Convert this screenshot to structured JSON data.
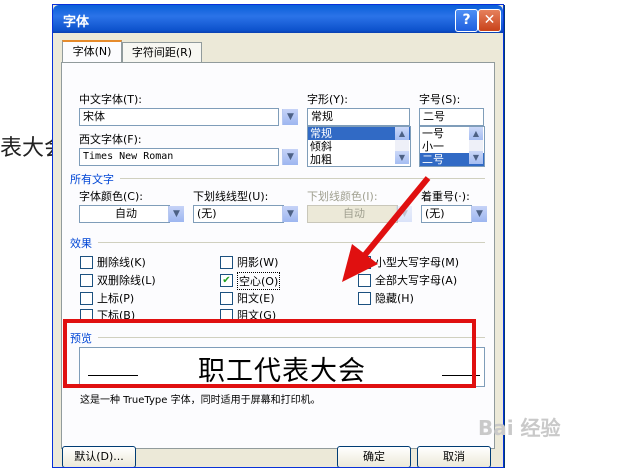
{
  "background_doc": {
    "text": "表大会"
  },
  "dialog": {
    "title": "字体",
    "help_icon_label": "?",
    "close_icon_label": "✕"
  },
  "tabs": [
    {
      "label": "字体(N)",
      "active": true
    },
    {
      "label": "字符间距(R)",
      "active": false
    }
  ],
  "font_section": {
    "chinese_font_label": "中文字体(T):",
    "chinese_font_value": "宋体",
    "western_font_label": "西文字体(F):",
    "western_font_value": "Times New Roman",
    "style_label": "字形(Y):",
    "style_value": "常规",
    "style_options": [
      "常规",
      "倾斜",
      "加粗"
    ],
    "size_label": "字号(S):",
    "size_value": "二号",
    "size_options": [
      "一号",
      "小一",
      "二号"
    ]
  },
  "all_text": {
    "group_title": "所有文字",
    "font_color_label": "字体颜色(C):",
    "font_color_value": "自动",
    "underline_style_label": "下划线线型(U):",
    "underline_style_value": "(无)",
    "underline_color_label": "下划线颜色(I):",
    "underline_color_value": "自动",
    "emphasis_label": "着重号(·):",
    "emphasis_value": "(无)"
  },
  "effects": {
    "group_title": "效果",
    "items": [
      {
        "label": "删除线(K)",
        "checked": false
      },
      {
        "label": "双删除线(L)",
        "checked": false
      },
      {
        "label": "上标(P)",
        "checked": false
      },
      {
        "label": "下标(B)",
        "checked": false
      },
      {
        "label": "阴影(W)",
        "checked": false
      },
      {
        "label": "空心(O)",
        "checked": true
      },
      {
        "label": "阳文(E)",
        "checked": false
      },
      {
        "label": "阴文(G)",
        "checked": false
      },
      {
        "label": "小型大写字母(M)",
        "checked": false
      },
      {
        "label": "全部大写字母(A)",
        "checked": false
      },
      {
        "label": "隐藏(H)",
        "checked": false
      }
    ]
  },
  "preview": {
    "group_title": "预览",
    "sample_text": "职工代表大会",
    "description": "这是一种 TrueType 字体，同时适用于屏幕和打印机。"
  },
  "buttons": {
    "default_label": "默认(D)...",
    "ok_label": "确定",
    "cancel_label": "取消"
  },
  "watermark": {
    "text": "Bai 经验"
  },
  "colors": {
    "title_bar": "#0a5fd8",
    "annotation": "#e01010",
    "selection": "#316ac5"
  }
}
